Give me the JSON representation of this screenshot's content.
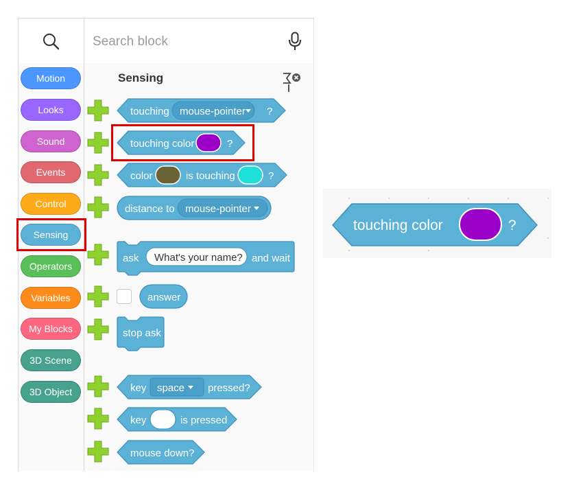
{
  "search": {
    "placeholder": "Search block"
  },
  "categories": [
    {
      "label": "Motion",
      "color": "#4c97ff"
    },
    {
      "label": "Looks",
      "color": "#9966ff"
    },
    {
      "label": "Sound",
      "color": "#cf63cf"
    },
    {
      "label": "Events",
      "color": "#e0686f"
    },
    {
      "label": "Control",
      "color": "#ffab19"
    },
    {
      "label": "Sensing",
      "color": "#5cb1d6"
    },
    {
      "label": "Operators",
      "color": "#59c059"
    },
    {
      "label": "Variables",
      "color": "#ff8c1a"
    },
    {
      "label": "My Blocks",
      "color": "#ff6680"
    },
    {
      "label": "3D Scene",
      "color": "#46a28f"
    },
    {
      "label": "3D Object",
      "color": "#46a28f"
    }
  ],
  "selected_category": "Sensing",
  "section": {
    "title": "Sensing"
  },
  "blocks": {
    "touching": {
      "label": "touching",
      "dropdown": "mouse-pointer",
      "q": "?"
    },
    "touching_color": {
      "label": "touching color",
      "q": "?",
      "swatch": "#9a00c8"
    },
    "color_touching": {
      "label1": "color",
      "label2": "is touching",
      "q": "?",
      "swatch1": "#6b6236",
      "swatch2": "#1ee0d8"
    },
    "distance_to": {
      "label": "distance to",
      "dropdown": "mouse-pointer"
    },
    "ask": {
      "label": "ask",
      "input": "What's your name?",
      "suffix": "and wait"
    },
    "answer": {
      "label": "answer"
    },
    "stop_ask": {
      "label": "stop ask"
    },
    "key_pressed": {
      "label1": "key",
      "dropdown": "space",
      "label2": "pressed?"
    },
    "key_is_pressed": {
      "label1": "key",
      "label2": "is pressed"
    },
    "mouse_down": {
      "label": "mouse down?"
    }
  },
  "zoom_block": {
    "label": "touching color",
    "q": "?",
    "swatch": "#9a00c8"
  },
  "colors": {
    "sensing_block": "#5cb1d6",
    "sensing_dark": "#3d8fb8",
    "plus_green": "#8fd12f",
    "highlight": "#e00000"
  }
}
